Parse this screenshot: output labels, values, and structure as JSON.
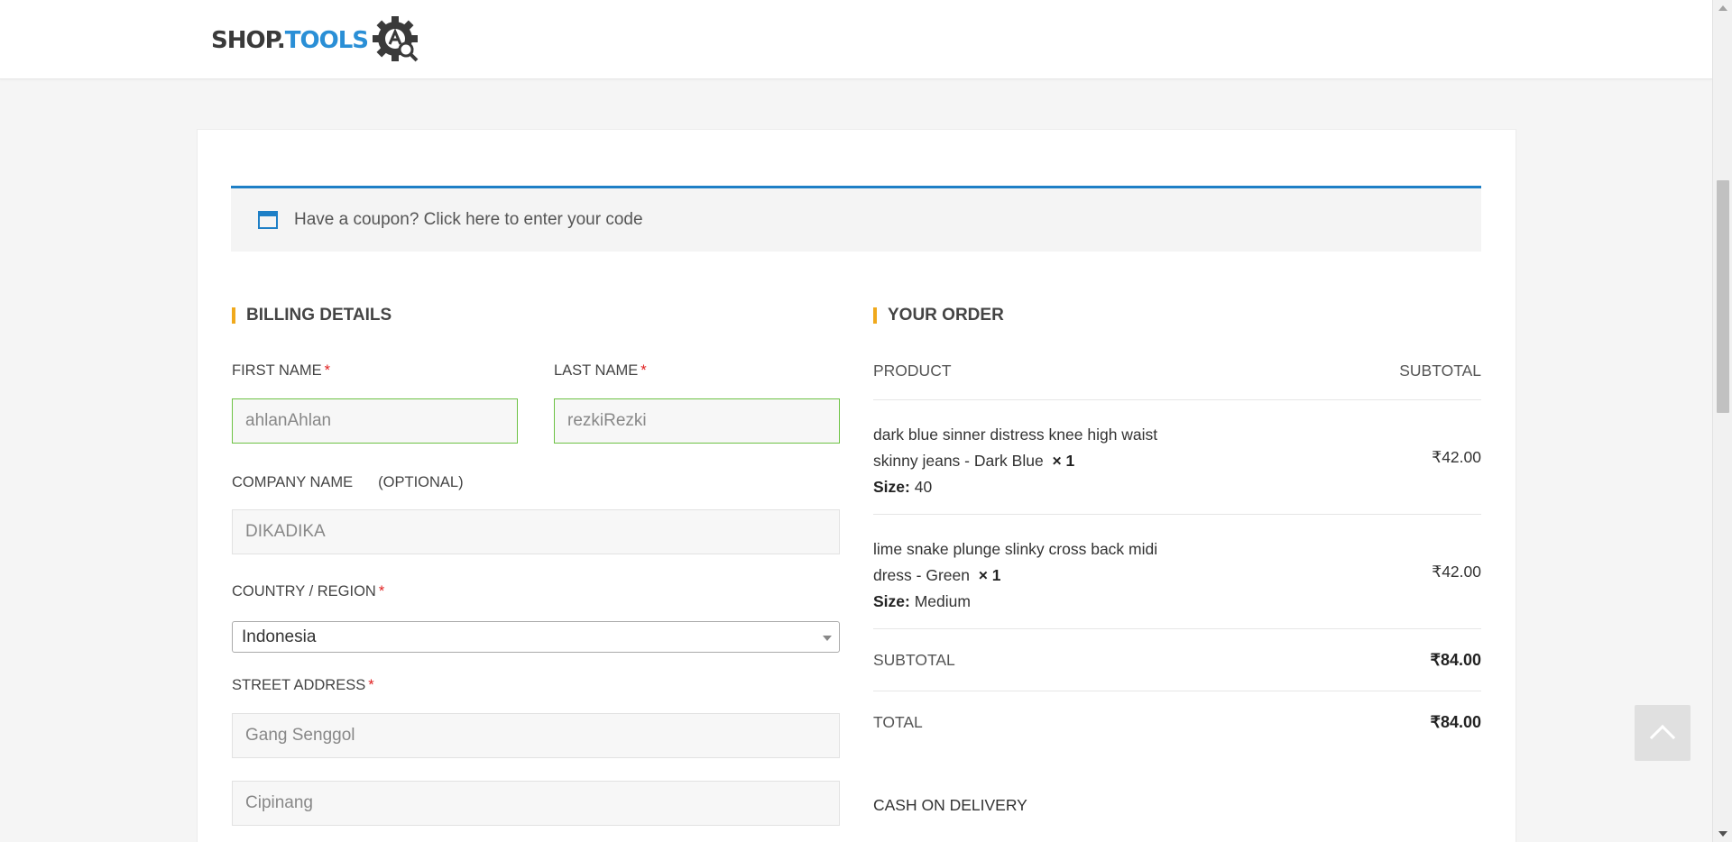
{
  "brand": {
    "logo_text_1": "SHOP.",
    "logo_text_2": "TOOLS",
    "logo_accent": "#2a8fd6"
  },
  "coupon": {
    "text": "Have a coupon? Click here to enter your code",
    "icon": "window-icon"
  },
  "billing": {
    "title": "BILLING DETAILS",
    "first_name": {
      "label": "FIRST NAME",
      "required": "*",
      "value": "ahlanAhlan"
    },
    "last_name": {
      "label": "LAST NAME",
      "required": "*",
      "value": "rezkiRezki"
    },
    "company": {
      "label": "COMPANY NAME",
      "optional": "(OPTIONAL)",
      "value": "DIKADIKA"
    },
    "country": {
      "label": "COUNTRY / REGION",
      "required": "*",
      "value": "Indonesia"
    },
    "street": {
      "label": "STREET ADDRESS",
      "required": "*",
      "line1": "Gang Senggol",
      "line2": "Cipinang"
    }
  },
  "order": {
    "title": "YOUR ORDER",
    "col_product": "PRODUCT",
    "col_subtotal": "SUBTOTAL",
    "items": [
      {
        "name_line1": "dark blue sinner distress knee high waist",
        "name_line2": "skinny jeans - Dark Blue",
        "qty": "× 1",
        "size_label": "Size:",
        "size": "40",
        "price": "₹42.00"
      },
      {
        "name_line1": "lime snake plunge slinky cross back midi",
        "name_line2": "dress - Green",
        "qty": "× 1",
        "size_label": "Size:",
        "size": "Medium",
        "price": "₹42.00"
      }
    ],
    "subtotal_label": "SUBTOTAL",
    "subtotal": "₹84.00",
    "total_label": "TOTAL",
    "total": "₹84.00",
    "payment": "CASH ON DELIVERY"
  },
  "colors": {
    "accent_blue": "#1e7fc6",
    "section_bar": "#f0a91c",
    "valid_border": "#6dc244",
    "required": "#e01f1f"
  }
}
